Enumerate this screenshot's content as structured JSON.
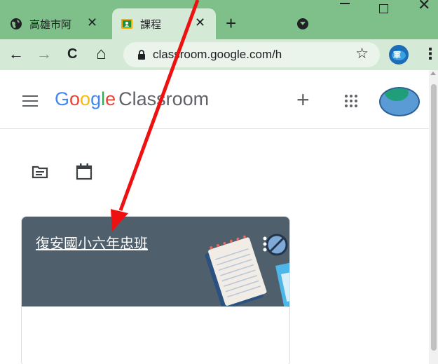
{
  "browser": {
    "tabs": [
      {
        "title": "高雄市阿",
        "close": "✕",
        "active": false
      },
      {
        "title": "課程",
        "close": "✕",
        "active": true
      }
    ],
    "new_tab": "+",
    "window_controls": {
      "close": "✕"
    },
    "nav": {
      "back": "←",
      "forward": "→",
      "reload": "C",
      "home": "⌂"
    },
    "url": "classroom.google.com/h",
    "bookmark_star": "☆",
    "profile_glyph": "軍",
    "menu": "⋮",
    "colors": {
      "frame": "#7fbf8a",
      "toolbar": "#d4ead6"
    }
  },
  "app": {
    "logo": {
      "letters": [
        "G",
        "o",
        "o",
        "g",
        "l",
        "e"
      ],
      "product": "Classroom"
    },
    "create_label": "+",
    "icons": [
      "menu-icon",
      "apps-icon",
      "avatar",
      "todo-icon",
      "calendar-icon"
    ]
  },
  "courses": [
    {
      "title": "復安國小六年忠班",
      "header_color": "#4f5f6c"
    }
  ],
  "annotation": {
    "color": "#ee1111"
  }
}
